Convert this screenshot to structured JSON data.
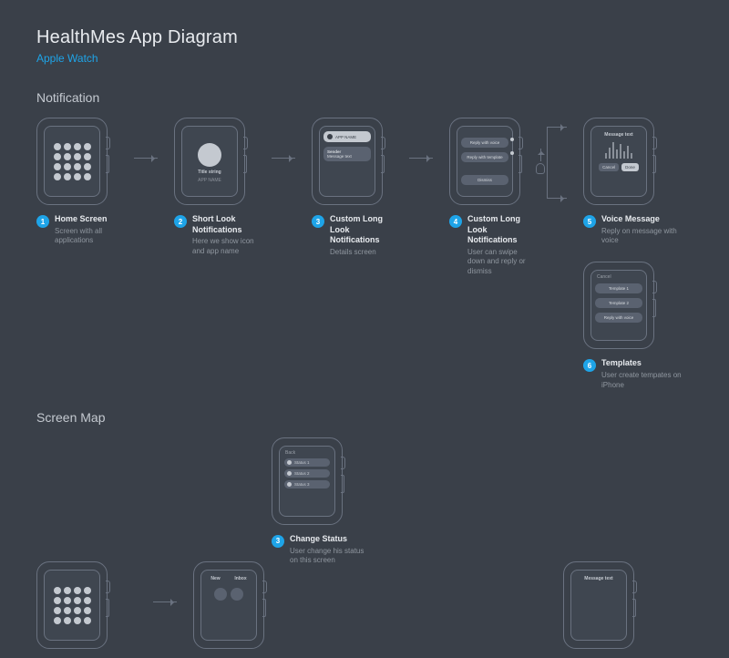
{
  "header": {
    "title": "HealthMes  App Diagram",
    "subtitle": "Apple Watch"
  },
  "sections": {
    "notification": "Notification",
    "screenmap": "Screen Map"
  },
  "steps": {
    "s1": {
      "num": "1",
      "title": "Home Screen",
      "sub": "Screen with all applications"
    },
    "s2": {
      "num": "2",
      "title": "Short Look Notifications",
      "sub": "Here we show icon and app name"
    },
    "s3": {
      "num": "3",
      "title": "Custom Long Look Notifications",
      "sub": "Details screen"
    },
    "s4": {
      "num": "4",
      "title": "Custom Long Look Notifications",
      "sub": "User can swipe down and reply or dismiss"
    },
    "s5": {
      "num": "5",
      "title": "Voice Message",
      "sub": "Reply on message with voice"
    },
    "s6": {
      "num": "6",
      "title": "Templates",
      "sub": "User create tempates on iPhone"
    },
    "sm3": {
      "num": "3",
      "title": "Change Status",
      "sub": "User change his status on this screen"
    }
  },
  "watch": {
    "shortlook": {
      "title": "Title string",
      "app": "APP NAME"
    },
    "longlook": {
      "app": "APP NAME",
      "sender": "Sender",
      "msg": "Message text"
    },
    "reply": {
      "voice": "Reply with voice",
      "template": "Reply with template",
      "dismiss": "Dismiss"
    },
    "voice": {
      "header": "Message text",
      "cancel": "Cancel",
      "done": "Done"
    },
    "templates": {
      "cancel": "Cancel",
      "t1": "Template 1",
      "t2": "Template 2",
      "voice": "Reply with voice"
    },
    "status": {
      "back": "Back",
      "s1": "Status 1",
      "s2": "Status 2",
      "s3": "Status 3"
    },
    "tabs": {
      "new": "New",
      "inbox": "Inbox"
    },
    "msg": {
      "header": "Message text"
    }
  }
}
